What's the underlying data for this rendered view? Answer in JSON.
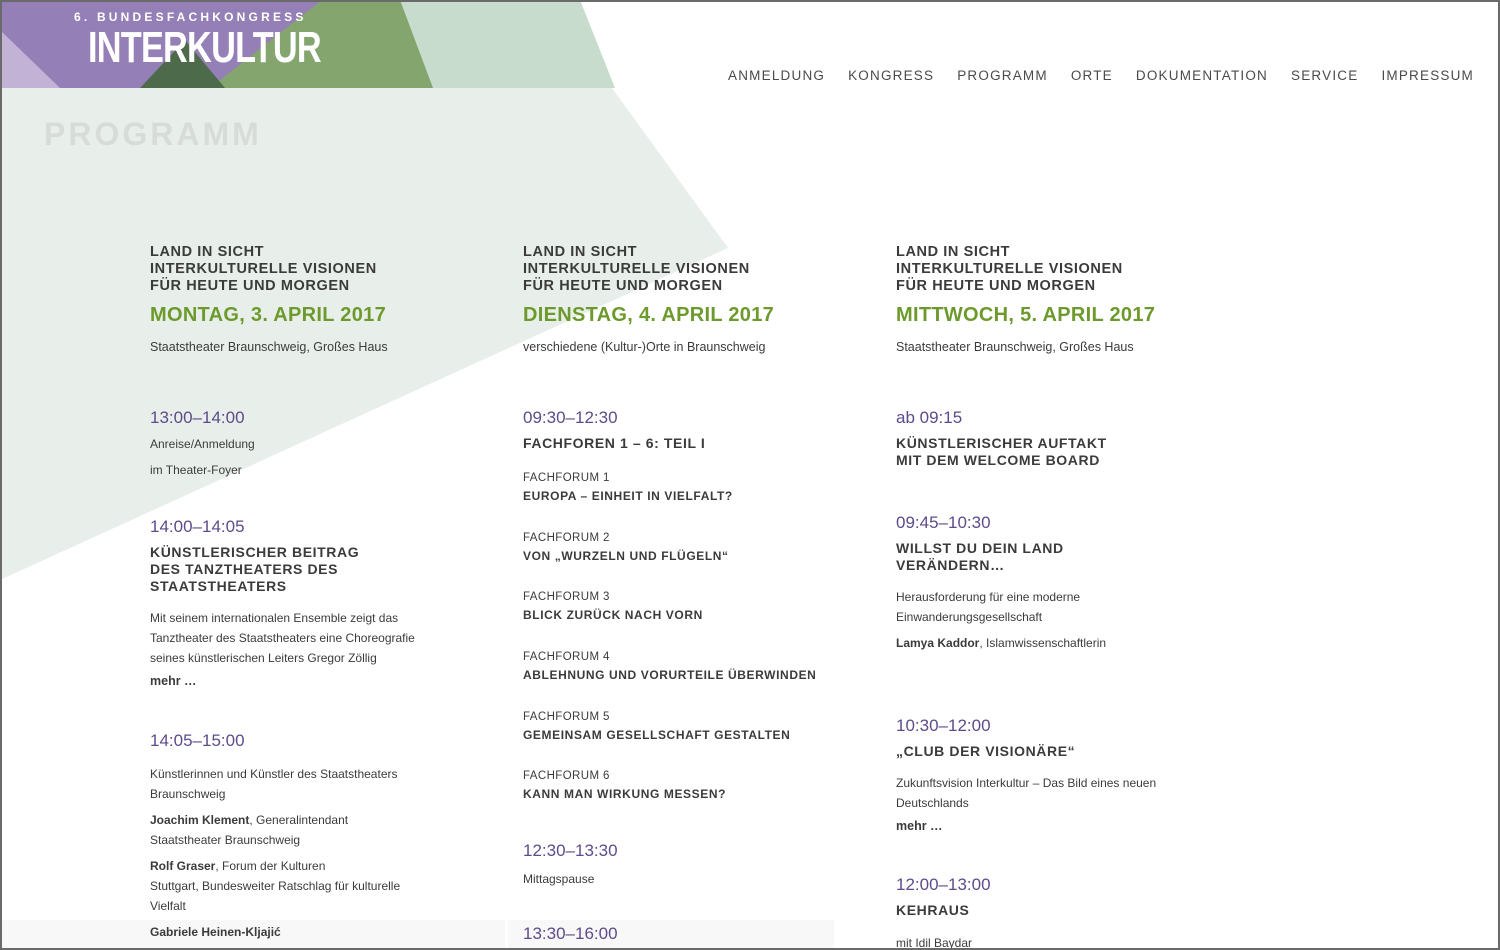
{
  "logo": {
    "kicker": "6. BUNDESFACHKONGRESS",
    "wordmark": "INTERKULTUR"
  },
  "nav": [
    "ANMELDUNG",
    "KONGRESS",
    "PROGRAMM",
    "ORTE",
    "DOKUMENTATION",
    "SERVICE",
    "IMPRESSUM"
  ],
  "page_title": "PROGRAMM",
  "colors": {
    "purple": "#5e4b8b",
    "green": "#6d9a2c",
    "text": "#3b3b3b"
  },
  "days": [
    {
      "head": [
        "LAND IN SICHT",
        "INTERKULTURELLE VISIONEN",
        "FÜR HEUTE UND MORGEN"
      ],
      "date": "MONTAG, 3. APRIL 2017",
      "venue": "Staatstheater Braunschweig, Großes Haus",
      "e1": {
        "time": "13:00–14:00",
        "l1": "Anreise/Anmeldung",
        "l2": "im Theater-Foyer"
      },
      "e2": {
        "time": "14:00–14:05",
        "title": [
          "KÜNSTLERISCHER BEITRAG",
          "DES TANZTHEATERS DES",
          "STAATSTHEATERS"
        ],
        "desc": [
          "Mit seinem internationalen Ensemble zeigt das",
          "Tanztheater des Staatstheaters eine Choreografie",
          "seines künstlerischen Leiters Gregor Zöllig"
        ],
        "more": "mehr …"
      },
      "e3": {
        "time": "14:05–15:00",
        "intro": [
          "Künstlerinnen und Künstler des Staatstheaters",
          "Braunschweig"
        ],
        "p1_name": "Joachim Klement",
        "p1_role": [
          ", Generalintendant",
          "Staatstheater Braunschweig"
        ],
        "p2_name": "Rolf Graser",
        "p2_role": [
          ", Forum der Kulturen",
          "Stuttgart, Bundesweiter Ratschlag für kulturelle",
          "Vielfalt"
        ],
        "p3_name": "Gabriele Heinen-Kljajić"
      }
    },
    {
      "head": [
        "LAND IN SICHT",
        "INTERKULTURELLE VISIONEN",
        "FÜR HEUTE UND MORGEN"
      ],
      "date": "DIENSTAG, 4. APRIL 2017",
      "venue": "verschiedene (Kultur-)Orte in Braunschweig",
      "e1": {
        "time": "09:30–12:30",
        "title": "FACHFOREN 1 – 6: TEIL I"
      },
      "forums": [
        {
          "label": "FACHFORUM 1",
          "title": "EUROPA – EINHEIT IN VIELFALT?"
        },
        {
          "label": "FACHFORUM 2",
          "title": "VON „WURZELN UND FLÜGELN“"
        },
        {
          "label": "FACHFORUM 3",
          "title": "BLICK ZURÜCK NACH VORN"
        },
        {
          "label": "FACHFORUM 4",
          "title": "ABLEHNUNG UND VORURTEILE ÜBERWINDEN"
        },
        {
          "label": "FACHFORUM 5",
          "title": "GEMEINSAM GESELLSCHAFT GESTALTEN"
        },
        {
          "label": "FACHFORUM 6",
          "title": "KANN MAN WIRKUNG MESSEN?"
        }
      ],
      "e2": {
        "time": "12:30–13:30",
        "text": "Mittagspause"
      },
      "e3": {
        "time": "13:30–16:00"
      }
    },
    {
      "head": [
        "LAND IN SICHT",
        "INTERKULTURELLE VISIONEN",
        "FÜR HEUTE UND MORGEN"
      ],
      "date": "MITTWOCH, 5. APRIL 2017",
      "venue": "Staatstheater Braunschweig, Großes Haus",
      "e1": {
        "time": "ab 09:15",
        "title": [
          "KÜNSTLERISCHER AUFTAKT",
          "MIT DEM WELCOME BOARD"
        ]
      },
      "e2": {
        "time": "09:45–10:30",
        "title": [
          "WILLST DU DEIN LAND",
          "VERÄNDERN…"
        ],
        "desc": [
          "Herausforderung für eine moderne",
          "Einwanderungsgesellschaft"
        ],
        "speaker_name": "Lamya Kaddor",
        "speaker_role": ", Islamwissenschaftlerin"
      },
      "e3": {
        "time": "10:30–12:00",
        "title": "„CLUB DER VISIONÄRE“",
        "desc": [
          "Zukunftsvision Interkultur – Das Bild eines neuen",
          "Deutschlands"
        ],
        "more": "mehr …"
      },
      "e4": {
        "time": "12:00–13:00",
        "title": "KEHRAUS",
        "text": "mit Idil Baydar"
      }
    }
  ]
}
